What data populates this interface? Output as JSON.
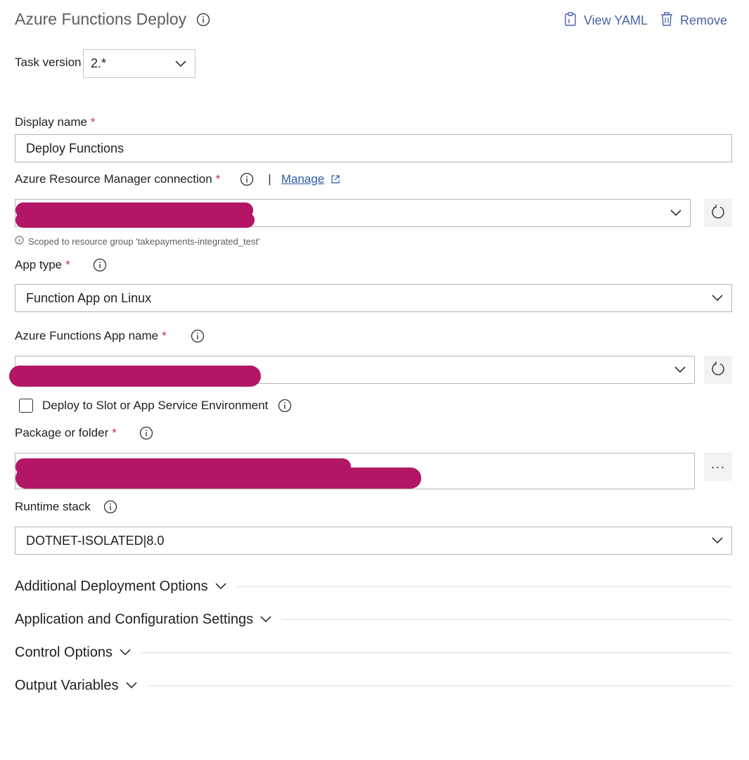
{
  "header": {
    "title": "Azure Functions Deploy",
    "view_yaml_label": "View YAML",
    "remove_label": "Remove"
  },
  "task_version": {
    "label": "Task version",
    "value": "2.*"
  },
  "display_name": {
    "label": "Display name",
    "required_mark": "*",
    "value": "Deploy Functions"
  },
  "arm_connection": {
    "label": "Azure Resource Manager connection",
    "required_mark": "*",
    "separator": "|",
    "manage_label": "Manage",
    "value": "",
    "value_redacted": true,
    "hint": "Scoped to resource group 'takepayments-integrated_test'"
  },
  "app_type": {
    "label": "App type",
    "required_mark": "*",
    "value": "Function App on Linux"
  },
  "function_app_name": {
    "label": "Azure Functions App name",
    "required_mark": "*",
    "value": "",
    "value_redacted": true
  },
  "deploy_slot": {
    "label": "Deploy to Slot or App Service Environment",
    "checked": false
  },
  "package": {
    "label": "Package or folder",
    "required_mark": "*",
    "value": "",
    "value_redacted": true,
    "browse_label": "···"
  },
  "runtime_stack": {
    "label": "Runtime stack",
    "value": "DOTNET-ISOLATED|8.0"
  },
  "sections": [
    {
      "label": "Additional Deployment Options"
    },
    {
      "label": "Application and Configuration Settings"
    },
    {
      "label": "Control Options"
    },
    {
      "label": "Output Variables"
    }
  ],
  "colors": {
    "link": "#4a63a8",
    "required": "#c4314b",
    "redaction": "#b31665",
    "border": "#b8b6b3"
  }
}
